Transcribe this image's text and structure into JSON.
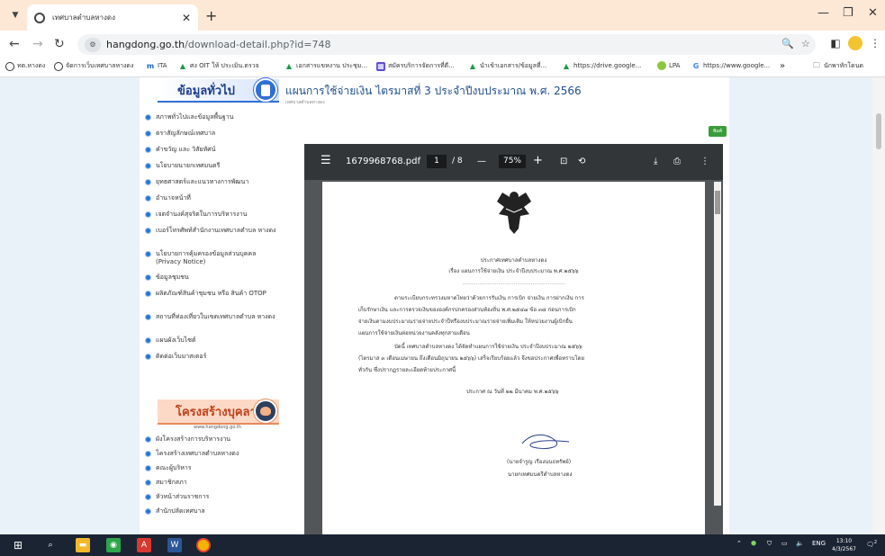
{
  "browser": {
    "tab_title": "เทศบาลตำบลหางดง",
    "url_host": "hangdong.go.th",
    "url_path": "/download-detail.php?id=748",
    "bookmarks": [
      "ทต.หางดง",
      "จัดการเว็บเทศบาลหางดง",
      "ITA",
      "ศง OIT ให้ ประเมิน.ตรวจ",
      "เอกสารแขหงาน ประชุม...",
      "สมัครบริการจัดการที่ดี...",
      "นำเข้าเอกสาร/ข้อมูลที่...",
      "https://drive.google...",
      "LPA",
      "https://www.google...",
      "นักพาทักโดนด"
    ],
    "bookmark_more": "»"
  },
  "sidebar": {
    "heading1": "ข้อมูลทั่วไป",
    "items1": [
      "สภาพทั่วไปและข้อมูลพื้นฐาน",
      "ตราสัญลักษณ์เทศบาล",
      "คำขวัญ และ วิสัยทัศน์",
      "นโยบายนายกเทศมนตรี",
      "ยุทธศาสตร์และแนวทางการพัฒนา",
      "อำนาจหน้าที่",
      "เจตจำนงค์สุจริตในการบริหารงาน",
      "เบอร์โทรศัพท์สำนักงานเทศบาลตำบล หางดง",
      "นโยบายการคุ้มครองข้อมูลส่วนบุคคล (Privacy Notice)",
      "ข้อมูลชุมชน",
      "ผลิตภัณฑ์สินค้าชุมชน หรือ สินค้า OTOP",
      "สถานที่ท่องเที่ยวในเขตเทศบาลตำบล หางดง",
      "แผนผังเว็บไซต์",
      "ติดต่อเว็บมาสเตอร์"
    ],
    "heading2": "โครงสร้างบุคลากร",
    "heading2_sub": "www.hangdong.go.th",
    "items2": [
      "ผังโครงสร้างการบริหารงาน",
      "โครงสร้างเทศบาลตำบลหางดง",
      "คณะผู้บริหาร",
      "สมาชิกสภา",
      "หัวหน้าส่วนราชการ",
      "สำนักปลัดเทศบาล"
    ]
  },
  "content": {
    "title": "แผนการใช้จ่ายเงิน ไตรมาสที่ 3 ประจำปีงบประมาณ พ.ศ. 2566",
    "breadcrumb": "เทศบาลตำบลหางดง",
    "print_label": "พิมพ์"
  },
  "pdf_viewer": {
    "filename": "1679968768.pdf",
    "page_current": "1",
    "page_total": "/ 8",
    "zoom": "75%",
    "doc": {
      "org": "ประกาศเทศบาลตำบลหางดง",
      "subject": "เรื่อง แผนการใช้จ่ายเงิน ประจำปีงบประมาณ พ.ศ.๒๕๖๖",
      "divider": "............................................................",
      "para1_lines": [
        "ตามระเบียบกระทรวงมหาดไทยว่าด้วยการรับเงิน การเบิก จ่ายเงิน การฝากเงิน การ",
        "เก็บรักษาเงิน และการตรวจเงินขององค์กรปกครองส่วนท้องถิ่น พ.ศ.๒๕๔๗ ข้อ ๓๘ ก่อนการเบิก",
        "จ่ายเงินตามงบประมาณรายจ่ายประจำปีหรืองบประมาณรายจ่ายเพิ่มเติม ให้หน่วยงานผู้เบิกยื่น",
        "แผนการใช้จ่ายเงินต่อหน่วยงานคลังทุกสามเดือน"
      ],
      "para2_lines": [
        "บัดนี้ เทศบาลตำบลหางดง ได้จัดทำแผนการใช้จ่ายเงิน ประจำปีงบประมาณ ๒๕๖๖",
        "(ไตรมาส ๓ เดือนเมษายน ถึงเดือนมิถุนายน ๒๕๖๖) เสร็จเรียบร้อยแล้ว จึงขอประกาศเพื่อทราบโดย",
        "ทั่วกัน ซึ่งปรากฏรายละเอียดท้ายประกาศนี้"
      ],
      "announce_date": "ประกาศ ณ วันที่ ๒๒ มีนาคม พ.ศ.๒๕๖๖",
      "signer_name": "(นายจำรูญ เรืองนนธทรัพย์)",
      "signer_title": "นายกเทศมนตรีตำบลหางดง"
    }
  },
  "taskbar": {
    "lang": "ENG",
    "time": "13:10",
    "date": "4/3/2567",
    "notif_count": "2"
  }
}
